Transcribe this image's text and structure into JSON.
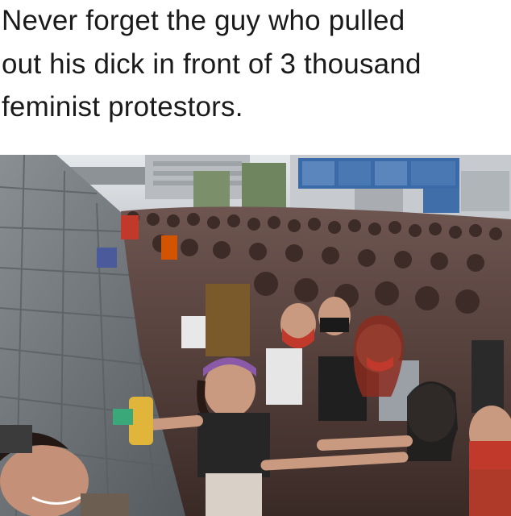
{
  "caption": {
    "lines": [
      "Never forget the guy who pulled",
      "out his dick in front of 3 thousand",
      "feminist protestors."
    ]
  },
  "photo": {
    "description_name": "crowd-protest-photo",
    "colors": {
      "sky": "#d9dde2",
      "building": "#3b6aa8",
      "wall": "#6f7478",
      "crowd": "#5a4038",
      "headscarf_purple": "#8a5aa8",
      "mask_red": "#c0392b"
    }
  }
}
